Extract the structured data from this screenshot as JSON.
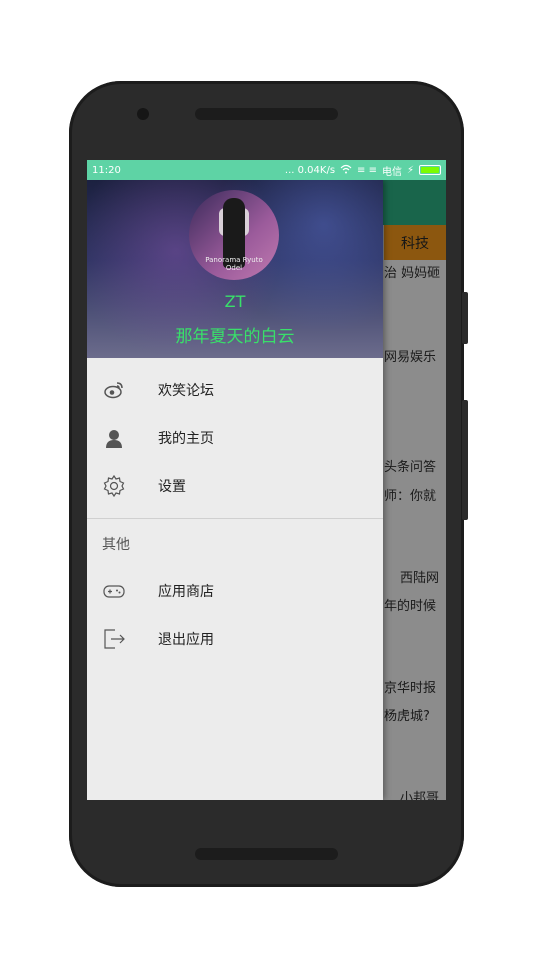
{
  "status_bar": {
    "time": "11:20",
    "net_speed": "... 0.04K/s",
    "signal": "≡ ≡",
    "carrier": "电信",
    "battery_level": 1.0
  },
  "background_app": {
    "active_tab": "科技",
    "fragments": [
      "治 妈妈砸",
      "网易娱乐",
      "头条问答",
      "师：你就",
      "西陆网",
      "年的时候",
      "京华时报",
      "杨虎城?",
      "小邦哥"
    ]
  },
  "drawer": {
    "header": {
      "avatar_caption": "Panorama Ryuto Odel",
      "username": "ZT",
      "signature": "那年夏天的白云"
    },
    "items": [
      {
        "icon": "weibo-icon",
        "label": "欢笑论坛"
      },
      {
        "icon": "person-icon",
        "label": "我的主页"
      },
      {
        "icon": "gear-icon",
        "label": "设置"
      }
    ],
    "section_title": "其他",
    "other_items": [
      {
        "icon": "gamepad-icon",
        "label": "应用商店"
      },
      {
        "icon": "exit-icon",
        "label": "退出应用"
      }
    ]
  },
  "colors": {
    "status_bar": "#5ed3a5",
    "accent_text": "#39e06a",
    "drawer_bg": "#ececec",
    "tab_active": "#ff9f1c"
  }
}
